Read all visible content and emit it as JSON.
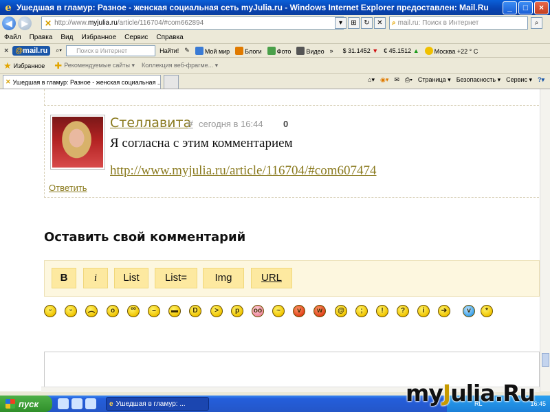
{
  "window": {
    "title": "Ушедшая в гламур: Разное - женская социальная сеть myJulia.ru - Windows Internet Explorer предоставлен: Mail.Ru",
    "minimize": "_",
    "maximize": "□",
    "close": "×"
  },
  "address": {
    "prefix": "http://www.",
    "domain": "myjulia.ru",
    "path": "/article/116704/#com662894",
    "search_placeholder": "mail.ru: Поиск в Интернет"
  },
  "menu": [
    "Файл",
    "Правка",
    "Вид",
    "Избранное",
    "Сервис",
    "Справка"
  ],
  "mailru_toolbar": {
    "logo": "mail.ru",
    "logo_at": "@",
    "search_placeholder": "Поиск в Интернет",
    "find_button": "Найти!",
    "items": [
      "Мой мир",
      "Блоги",
      "Фото",
      "Видео"
    ],
    "usd": "$ 31.1452",
    "eur": "€ 45.1512",
    "weather": "Москва +22 ° C"
  },
  "favorites_bar": {
    "favorites": "Избранное",
    "links": [
      "Рекомендуемые сайты ▾",
      "Коллекция веб-фрагме... ▾"
    ]
  },
  "tabs": {
    "active": "Ушедшая в гламур: Разное - женская социальная ...",
    "tools": [
      "Страница ▾",
      "Безопасность ▾",
      "Сервис ▾"
    ]
  },
  "comment": {
    "author": "Стеллавита",
    "anchor": "#",
    "date": "сегодня в 16:44",
    "score": "0",
    "text": "Я согласна с этим комментарием",
    "link": "http://www.myjulia.ru/article/116704/#com607474",
    "reply": "Ответить"
  },
  "form": {
    "heading": "Оставить свой комментарий",
    "buttons": [
      "B",
      "i",
      "List",
      "List=",
      "Img",
      "URL"
    ]
  },
  "smileys": [
    "smile-icon",
    "happy-icon",
    "sad-icon",
    "shocked-icon",
    "glasses-icon",
    "neutral-icon",
    "cool-icon",
    "laugh-icon",
    "angry-icon",
    "tongue-icon",
    "pig-icon",
    "unsure-icon",
    "devil-icon",
    "evil-icon",
    "confused-icon",
    "wink-icon",
    "exclamation-icon",
    "question-icon",
    "idea-icon",
    "arrow-icon",
    "bird-icon",
    "kiss-icon"
  ],
  "taskbar": {
    "start": "пуск",
    "task": "Ушедшая в гламур: ...",
    "lang": "RL",
    "clock": "16:45"
  },
  "watermark": {
    "pre": "my",
    "accent": "J",
    "post": "ulia.Ru"
  }
}
